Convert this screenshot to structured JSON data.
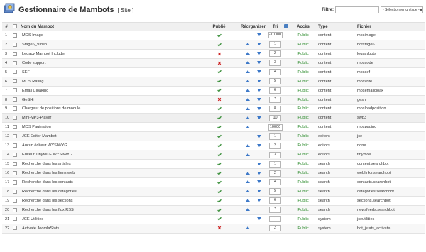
{
  "header": {
    "title": "Gestionnaire de Mambots",
    "subtitle": "[ Site ]",
    "filter_label": "Filtre:",
    "filter_value": "",
    "type_select": "- Sélectionner un type -"
  },
  "columns": {
    "num": "#",
    "name": "Nom du Mambot",
    "published": "Publié",
    "reorder": "Réorganiser",
    "order": "Tri",
    "access": "Accès",
    "type": "Type",
    "file": "Fichier"
  },
  "icons": {
    "published": "green-check-icon",
    "unpublished": "red-cross-icon",
    "up": "arrow-up-icon",
    "down": "arrow-down-icon",
    "save": "save-order-icon"
  },
  "colors": {
    "published": "#3a8f3a",
    "unpublished": "#cc2222",
    "access": "#2a8a2a",
    "arrow": "#3c78c8"
  },
  "rows": [
    {
      "num": "1",
      "name": "MOS Image",
      "published": true,
      "up": false,
      "down": true,
      "order": "-10000",
      "access": "Public",
      "type": "content",
      "file": "mosimage"
    },
    {
      "num": "2",
      "name": "Stage6_Video",
      "published": true,
      "up": true,
      "down": true,
      "order": "1",
      "access": "Public",
      "type": "content",
      "file": "botstage6"
    },
    {
      "num": "3",
      "name": "Legacy Mambot Includer",
      "published": false,
      "up": true,
      "down": true,
      "order": "2",
      "access": "Public",
      "type": "content",
      "file": "legacybots"
    },
    {
      "num": "4",
      "name": "Code support",
      "published": false,
      "up": true,
      "down": true,
      "order": "3",
      "access": "Public",
      "type": "content",
      "file": "moscode"
    },
    {
      "num": "5",
      "name": "SEF",
      "published": true,
      "up": true,
      "down": true,
      "order": "4",
      "access": "Public",
      "type": "content",
      "file": "mossef"
    },
    {
      "num": "6",
      "name": "MOS Rating",
      "published": true,
      "up": true,
      "down": true,
      "order": "5",
      "access": "Public",
      "type": "content",
      "file": "mosvote"
    },
    {
      "num": "7",
      "name": "Email Cloaking",
      "published": true,
      "up": true,
      "down": true,
      "order": "6",
      "access": "Public",
      "type": "content",
      "file": "mosemailcloak"
    },
    {
      "num": "8",
      "name": "GeSHi",
      "published": false,
      "up": true,
      "down": true,
      "order": "7",
      "access": "Public",
      "type": "content",
      "file": "geshi"
    },
    {
      "num": "9",
      "name": "Chargeur de positions de module",
      "published": true,
      "up": true,
      "down": true,
      "order": "8",
      "access": "Public",
      "type": "content",
      "file": "mosloadposition"
    },
    {
      "num": "10",
      "name": "Mini-MP3-Player",
      "published": true,
      "up": true,
      "down": true,
      "order": "10",
      "access": "Public",
      "type": "content",
      "file": "swp3"
    },
    {
      "num": "11",
      "name": "MOS Pagination",
      "published": true,
      "up": true,
      "down": false,
      "order": "10000",
      "access": "Public",
      "type": "content",
      "file": "mospaging"
    },
    {
      "num": "12",
      "name": "JCE Editor Mambot",
      "published": true,
      "up": false,
      "down": true,
      "order": "1",
      "access": "Public",
      "type": "editors",
      "file": "jce"
    },
    {
      "num": "13",
      "name": "Aucun éditeur WYSIWYG",
      "published": true,
      "up": true,
      "down": true,
      "order": "2",
      "access": "Public",
      "type": "editors",
      "file": "none"
    },
    {
      "num": "14",
      "name": "Editeur TinyMCE WYSIWYG",
      "published": true,
      "up": true,
      "down": false,
      "order": "3",
      "access": "Public",
      "type": "editors",
      "file": "tinymce"
    },
    {
      "num": "15",
      "name": "Recherche dans les articles",
      "published": true,
      "up": false,
      "down": true,
      "order": "1",
      "access": "Public",
      "type": "search",
      "file": "content.searchbot"
    },
    {
      "num": "16",
      "name": "Recherche dans les liens web",
      "published": true,
      "up": true,
      "down": true,
      "order": "2",
      "access": "Public",
      "type": "search",
      "file": "weblinks.searchbot"
    },
    {
      "num": "17",
      "name": "Recherche dans les contacts",
      "published": true,
      "up": true,
      "down": true,
      "order": "4",
      "access": "Public",
      "type": "search",
      "file": "contacts.searchbot"
    },
    {
      "num": "18",
      "name": "Recherche dans les catégories",
      "published": true,
      "up": true,
      "down": true,
      "order": "5",
      "access": "Public",
      "type": "search",
      "file": "categories.searchbot"
    },
    {
      "num": "19",
      "name": "Recherche dans les sections",
      "published": true,
      "up": true,
      "down": true,
      "order": "6",
      "access": "Public",
      "type": "search",
      "file": "sections.searchbot"
    },
    {
      "num": "20",
      "name": "Recherche dans les flux RSS",
      "published": true,
      "up": true,
      "down": false,
      "order": "7",
      "access": "Public",
      "type": "search",
      "file": "newsfeeds.searchbot"
    },
    {
      "num": "21",
      "name": "JCE Utilities",
      "published": true,
      "up": false,
      "down": true,
      "order": "1",
      "access": "Public",
      "type": "system",
      "file": "jceutilities"
    },
    {
      "num": "22",
      "name": "Activate JoomlaStats",
      "published": false,
      "up": true,
      "down": false,
      "order": "2",
      "access": "Public",
      "type": "system",
      "file": "bot_jstats_activate"
    }
  ]
}
